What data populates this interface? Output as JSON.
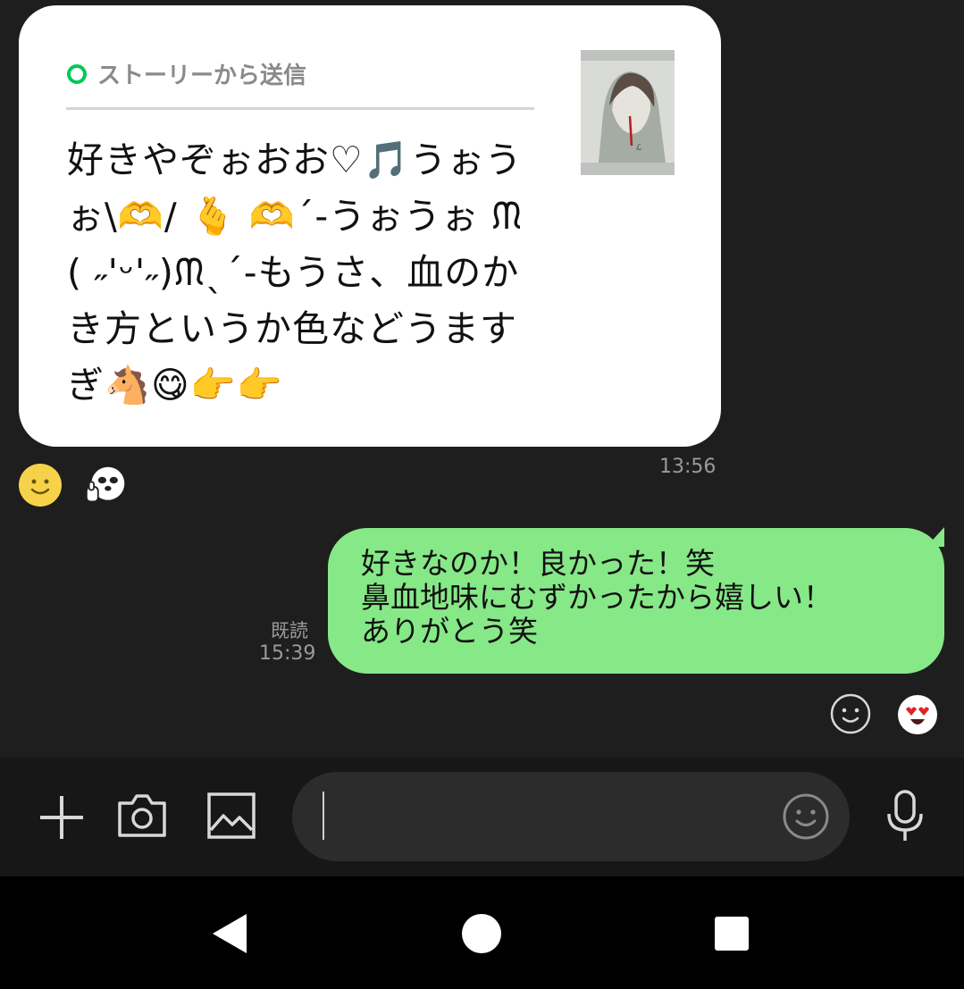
{
  "incoming": {
    "story_label": "ストーリーから送信",
    "message": "好きやぞぉおお♡🎵うぉうぉ\\🫶/ 🫰 🫶ˊ-うぉうぉ ᙏ( ˶'ᵕ'˶)ᙏˎˊ-もうさ、血のかき方というか色などうますぎ🐴😋👉👉",
    "time": "13:56"
  },
  "outgoing": {
    "message": "好きなのか！良かった！笑\n鼻血地味にむずかったから嬉しい！\nありがとう笑",
    "read_label": "既読",
    "time": "15:39"
  },
  "reactions": {
    "in_smiley_icon": "smiley-face-icon",
    "in_sticker_icon": "panda-sticker-icon",
    "out_smiley_icon": "add-reaction-icon",
    "out_reaction_icon": "heart-eyes-reaction-icon"
  },
  "input": {
    "placeholder": "",
    "icons": [
      "plus-icon",
      "camera-icon",
      "image-icon",
      "emoji-icon",
      "microphone-icon"
    ]
  },
  "colors": {
    "background": "#1e1e1e",
    "incoming_bubble": "#ffffff",
    "outgoing_bubble": "#86e887",
    "story_green": "#06c755",
    "meta_text": "#9a9a9a"
  }
}
